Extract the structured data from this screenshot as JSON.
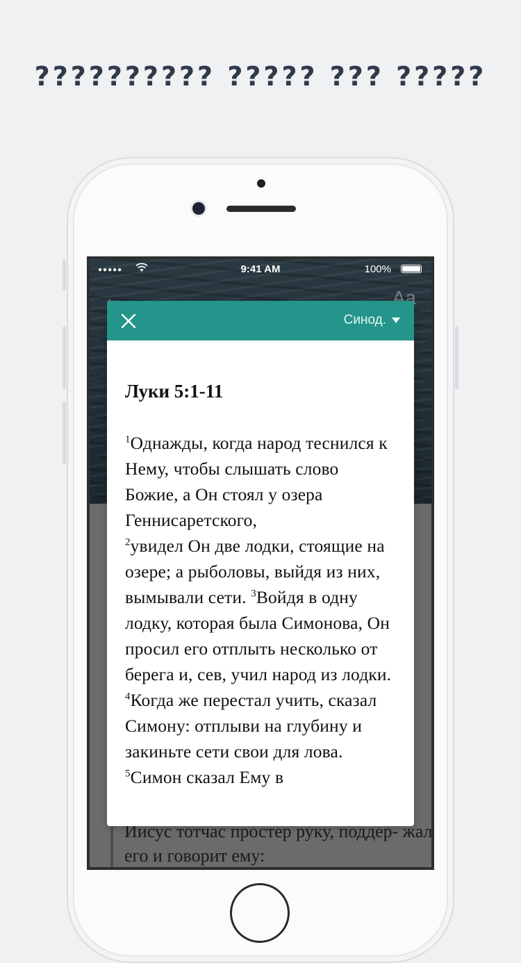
{
  "headline": "?????????? ????? ??? ?????",
  "status_bar": {
    "signal": "●●●●●",
    "time": "9:41 AM",
    "battery_percent": "100%"
  },
  "reader_toolbar": {
    "back_icon": "arrow-left-icon",
    "font_icon": "font-size-icon"
  },
  "modal": {
    "close_icon": "close-icon",
    "version_label": "Синод.",
    "passage_reference": "Луки 5:1-11",
    "verses": [
      {
        "num": "1",
        "text": "Однажды, когда народ теснился к Нему, чтобы слышать слово Божие, а Он стоял у озера Геннисаретского,"
      },
      {
        "num": "2",
        "text": "увидел Он две лодки, стоящие на озере; а рыболовы, выйдя из них, вымывали сети. "
      },
      {
        "num": "3",
        "text": "Войдя в одну лодку, которая была Симонова, Он просил его отплыть несколько от берега и, сев, учил народ из лодки."
      },
      {
        "num": "4",
        "text": "Когда же перестал учить, сказал Симону: отплыви на глубину и закиньте сети свои для лова. "
      },
      {
        "num": "5",
        "text": "Симон сказал Ему в"
      }
    ]
  },
  "background_text": "Иисус тотчас простер руку, поддер- жал его и говорит ему:"
}
